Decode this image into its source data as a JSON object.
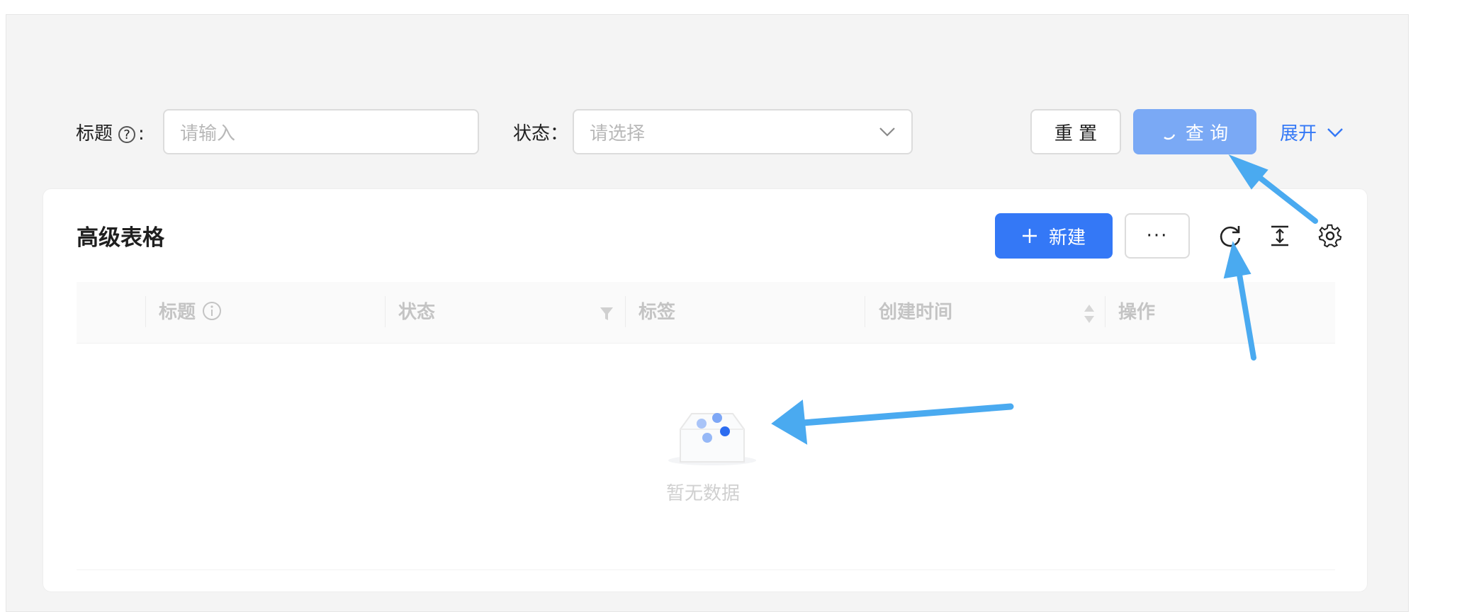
{
  "filter": {
    "title_label": "标题",
    "title_help_icon": "?",
    "title_colon": ":",
    "title_placeholder": "请输入",
    "status_label": "状态：",
    "status_placeholder": "请选择",
    "reset_label": "重 置",
    "query_label": "查 询",
    "expand_label": "展开"
  },
  "card": {
    "title": "高级表格",
    "new_button_label": "新建",
    "more_button_label": "···"
  },
  "table": {
    "columns": [
      "标题",
      "状态",
      "标签",
      "创建时间",
      "操作"
    ],
    "empty_text": "暂无数据"
  },
  "colors": {
    "primary": "#3478f6",
    "primary_loading": "#7aa9f5",
    "annotation_arrow": "#4aaaf0"
  },
  "icons": {
    "refresh": "refresh-icon",
    "column_height": "column-height-icon",
    "settings": "gear-icon",
    "filter": "filter-icon",
    "sort": "sort-icon",
    "info": "info-icon",
    "empty": "empty-box-icon"
  }
}
